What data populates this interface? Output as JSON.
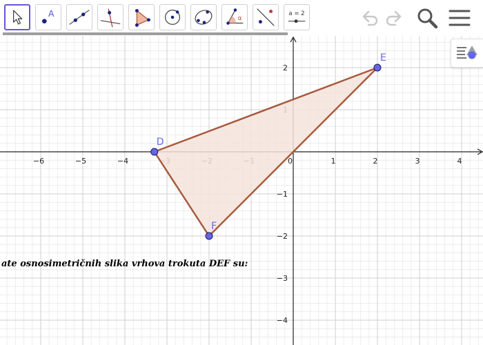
{
  "toolbar": {
    "tools": [
      {
        "name": "move-tool",
        "icon": "arrow-pointer-icon",
        "selected": true
      },
      {
        "name": "point-tool",
        "icon": "point-icon",
        "label": "A"
      },
      {
        "name": "line-tool",
        "icon": "line-through-points-icon"
      },
      {
        "name": "perpendicular-line-tool",
        "icon": "perpendicular-line-icon"
      },
      {
        "name": "polygon-tool",
        "icon": "polygon-icon"
      },
      {
        "name": "circle-center-point-tool",
        "icon": "circle-center-point-icon"
      },
      {
        "name": "conic-five-points-tool",
        "icon": "conic-five-points-icon"
      },
      {
        "name": "angle-tool",
        "icon": "angle-icon",
        "label": "α"
      },
      {
        "name": "reflect-about-line-tool",
        "icon": "reflect-about-line-icon"
      },
      {
        "name": "slider-tool",
        "icon": "slider-icon",
        "label": "a = 2"
      }
    ],
    "actions": [
      {
        "name": "undo-button",
        "icon": "undo-icon",
        "enabled": false
      },
      {
        "name": "redo-button",
        "icon": "redo-icon",
        "enabled": false
      },
      {
        "name": "search-button",
        "icon": "search-icon",
        "enabled": true
      },
      {
        "name": "menu-button",
        "icon": "hamburger-menu-icon",
        "enabled": true
      }
    ]
  },
  "graphics": {
    "axes": {
      "x_ticks": [
        "−6",
        "−5",
        "−4",
        "−3",
        "−2",
        "−1",
        "0",
        "1",
        "2",
        "3",
        "4"
      ],
      "y_ticks": [
        "2",
        "1",
        "−1",
        "−2",
        "−3",
        "−4"
      ]
    },
    "points": [
      {
        "label": "D",
        "x": -3.3,
        "y": 0
      },
      {
        "label": "E",
        "x": 2,
        "y": 2
      },
      {
        "label": "F",
        "x": -2,
        "y": -2
      }
    ],
    "polygon": {
      "vertices": [
        "D",
        "E",
        "F"
      ]
    },
    "colors": {
      "point_fill": "#6566e8",
      "point_label": "#6a6ae0",
      "polygon_stroke": "#a75a3d",
      "polygon_fill": "#f5e3dc",
      "grid_major": "#cfcfcf",
      "grid_minor": "#ececec",
      "accent": "#6557d2"
    }
  },
  "style_bar_toggle": {
    "icon": "style-bar-icon"
  },
  "text": {
    "task": "ate osnosimetričnih slika vrhova trokuta DEF su:"
  }
}
